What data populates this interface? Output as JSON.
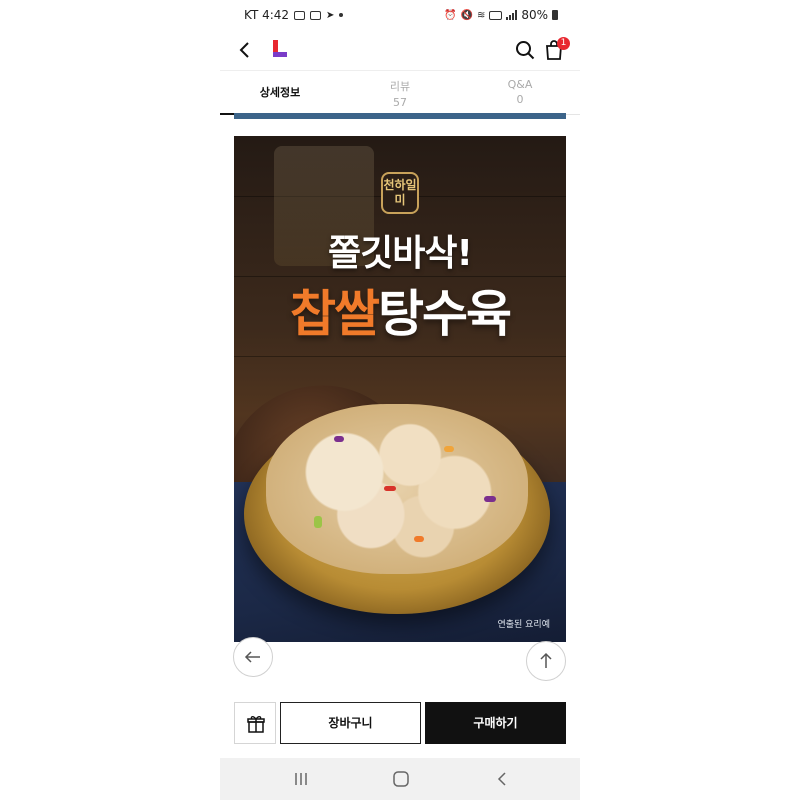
{
  "status_bar": {
    "carrier_time": "KT 4:42",
    "battery": "80%"
  },
  "header": {
    "logo": "L",
    "cart_count": "1"
  },
  "tabs": [
    {
      "label": "상세정보",
      "count": ""
    },
    {
      "label": "리뷰",
      "count": "57"
    },
    {
      "label": "Q&A",
      "count": "0"
    }
  ],
  "product_image": {
    "brand_mark": "천하일미",
    "tagline": "쫄깃바삭!",
    "title_accent": "찹쌀",
    "title_rest": "탕수육",
    "note": "연출된 요리예"
  },
  "actions": {
    "cart_label": "장바구니",
    "buy_label": "구매하기"
  },
  "colors": {
    "accent_orange": "#f07a2a",
    "badge_red": "#e8272f",
    "divider_blue": "#3c6489"
  }
}
